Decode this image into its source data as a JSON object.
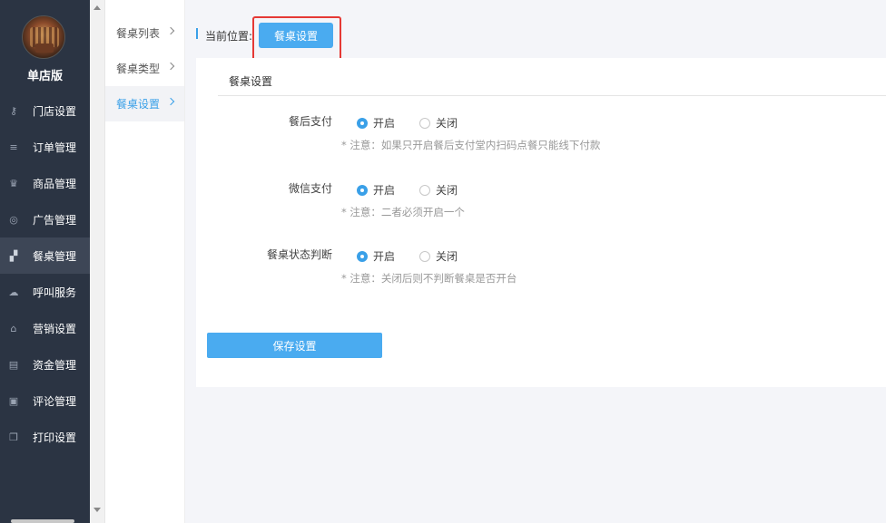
{
  "sidebar": {
    "shop_name": "单店版",
    "items": [
      {
        "label": "门店设置",
        "icon": "key-icon",
        "glyph": "⚷"
      },
      {
        "label": "订单管理",
        "icon": "menu-icon",
        "glyph": "≡"
      },
      {
        "label": "商品管理",
        "icon": "trophy-icon",
        "glyph": "♛"
      },
      {
        "label": "广告管理",
        "icon": "lifebuoy-icon",
        "glyph": "◎"
      },
      {
        "label": "餐桌管理",
        "icon": "binoculars-icon",
        "glyph": "▞"
      },
      {
        "label": "呼叫服务",
        "icon": "cloud-icon",
        "glyph": "☁"
      },
      {
        "label": "营销设置",
        "icon": "gift-icon",
        "glyph": "⌂"
      },
      {
        "label": "资金管理",
        "icon": "book-icon",
        "glyph": "▤"
      },
      {
        "label": "评论管理",
        "icon": "money-icon",
        "glyph": "▣"
      },
      {
        "label": "打印设置",
        "icon": "copy-icon",
        "glyph": "❐"
      }
    ],
    "active_index": 4
  },
  "submenu": {
    "items": [
      {
        "label": "餐桌列表"
      },
      {
        "label": "餐桌类型"
      },
      {
        "label": "餐桌设置"
      }
    ],
    "active_index": 2
  },
  "breadcrumb": {
    "label": "当前位置:",
    "current": "餐桌设置"
  },
  "panel": {
    "title": "餐桌设置",
    "fields": [
      {
        "label": "餐后支付",
        "options": [
          "开启",
          "关闭"
        ],
        "selected": 0,
        "note": "* 注意：如果只开启餐后支付堂内扫码点餐只能线下付款"
      },
      {
        "label": "微信支付",
        "options": [
          "开启",
          "关闭"
        ],
        "selected": 0,
        "note": "* 注意：二者必须开启一个"
      },
      {
        "label": "餐桌状态判断",
        "options": [
          "开启",
          "关闭"
        ],
        "selected": 0,
        "note": "* 注意：关闭后则不判断餐桌是否开台"
      }
    ],
    "save_label": "保存设置"
  },
  "colors": {
    "sidebar_bg": "#2b3443",
    "accent": "#4aabf0",
    "highlight": "#e53935"
  }
}
